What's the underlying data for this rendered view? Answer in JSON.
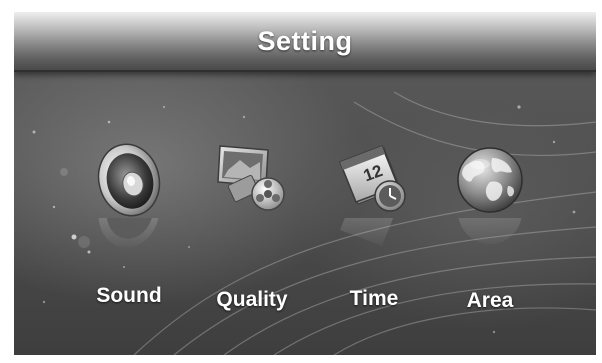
{
  "header": {
    "title": "Setting"
  },
  "menu": {
    "items": [
      {
        "label": "Sound",
        "icon": "speaker-icon"
      },
      {
        "label": "Quality",
        "icon": "picture-quality-icon"
      },
      {
        "label": "Time",
        "icon": "calendar-clock-icon"
      },
      {
        "label": "Area",
        "icon": "globe-icon"
      }
    ]
  },
  "calendar": {
    "day": "12"
  },
  "colors": {
    "background": "#505050",
    "title_bar": "#8a8a8a",
    "text": "#ffffff"
  }
}
